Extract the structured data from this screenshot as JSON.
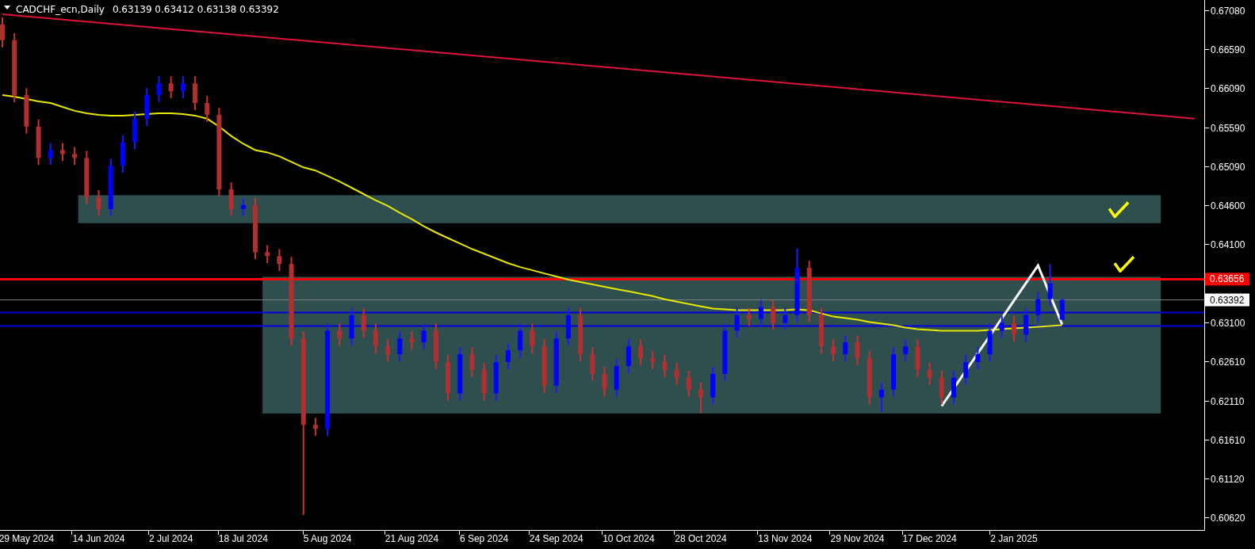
{
  "header": {
    "symbol": "CADCHF_ecn,Daily",
    "quotes": "0.63139 0.63412 0.63138 0.63392"
  },
  "chart": {
    "chart_data": {
      "type": "candlestick",
      "ylim": [
        0.60461,
        0.67212
      ],
      "yticks": [
        {
          "value": 0.6708,
          "label": "0.67080"
        },
        {
          "value": 0.6659,
          "label": "0.66590"
        },
        {
          "value": 0.6609,
          "label": "0.66090"
        },
        {
          "value": 0.6559,
          "label": "0.65590"
        },
        {
          "value": 0.6509,
          "label": "0.65090"
        },
        {
          "value": 0.646,
          "label": "0.64600"
        },
        {
          "value": 0.641,
          "label": "0.64100"
        },
        {
          "value": 0.631,
          "label": "0.63100"
        },
        {
          "value": 0.6261,
          "label": "0.62610"
        },
        {
          "value": 0.6211,
          "label": "0.62110"
        },
        {
          "value": 0.6161,
          "label": "0.61610"
        },
        {
          "value": 0.6112,
          "label": "0.61120"
        },
        {
          "value": 0.6062,
          "label": "0.60620"
        }
      ],
      "categories": [
        null,
        null,
        "29 May 2024",
        null,
        null,
        null,
        null,
        null,
        "14 Jun 2024",
        null,
        null,
        null,
        null,
        null,
        "2 Jul 2024",
        null,
        null,
        null,
        null,
        null,
        "18 Jul 2024",
        null,
        null,
        null,
        null,
        null,
        null,
        "5 Aug 2024",
        null,
        null,
        null,
        null,
        null,
        null,
        "21 Aug 2024",
        null,
        null,
        null,
        null,
        null,
        "6 Sep 2024",
        null,
        null,
        null,
        null,
        null,
        "24 Sep 2024",
        null,
        null,
        null,
        null,
        null,
        "10 Oct 2024",
        null,
        null,
        null,
        null,
        null,
        "28 Oct 2024",
        null,
        null,
        null,
        null,
        null,
        null,
        "13 Nov 2024",
        null,
        null,
        null,
        null,
        null,
        "29 Nov 2024",
        null,
        null,
        null,
        null,
        null,
        "17 Dec 2024",
        null,
        null,
        null,
        null,
        null,
        null,
        "2 Jan 2025",
        null,
        null,
        null,
        null,
        null,
        null,
        null,
        null,
        null,
        null,
        null,
        null,
        null,
        null,
        null
      ],
      "ohlc": [
        [
          0.669,
          0.6699,
          0.6661,
          0.667
        ],
        [
          0.667,
          0.6679,
          0.6591,
          0.66
        ],
        [
          0.66,
          0.6609,
          0.6551,
          0.656
        ],
        [
          0.656,
          0.6569,
          0.6511,
          0.652
        ],
        [
          0.652,
          0.6539,
          0.6511,
          0.653
        ],
        [
          0.653,
          0.6539,
          0.6516,
          0.6525
        ],
        [
          0.6525,
          0.6534,
          0.6511,
          0.652
        ],
        [
          0.652,
          0.6529,
          0.6461,
          0.647
        ],
        [
          0.647,
          0.6479,
          0.6446,
          0.6455
        ],
        [
          0.6455,
          0.6519,
          0.6446,
          0.651
        ],
        [
          0.651,
          0.6549,
          0.6501,
          0.654
        ],
        [
          0.654,
          0.6579,
          0.6531,
          0.657
        ],
        [
          0.657,
          0.6609,
          0.6561,
          0.66
        ],
        [
          0.66,
          0.6624,
          0.6591,
          0.6615
        ],
        [
          0.6615,
          0.6624,
          0.6596,
          0.6605
        ],
        [
          0.6605,
          0.6624,
          0.6596,
          0.6615
        ],
        [
          0.6615,
          0.6624,
          0.6581,
          0.659
        ],
        [
          0.659,
          0.6599,
          0.6566,
          0.6575
        ],
        [
          0.6575,
          0.6584,
          0.6471,
          0.648
        ],
        [
          0.648,
          0.6489,
          0.6446,
          0.6455
        ],
        [
          0.6455,
          0.6469,
          0.6446,
          0.646
        ],
        [
          0.646,
          0.6469,
          0.6391,
          0.64
        ],
        [
          0.64,
          0.6409,
          0.6386,
          0.6395
        ],
        [
          0.6395,
          0.6404,
          0.6376,
          0.6385
        ],
        [
          0.6385,
          0.6394,
          0.6281,
          0.629
        ],
        [
          0.629,
          0.6299,
          0.6065,
          0.618
        ],
        [
          0.618,
          0.6189,
          0.6166,
          0.6175
        ],
        [
          0.6175,
          0.6309,
          0.6166,
          0.63
        ],
        [
          0.63,
          0.6309,
          0.6281,
          0.629
        ],
        [
          0.629,
          0.6329,
          0.6281,
          0.632
        ],
        [
          0.632,
          0.6329,
          0.6291,
          0.63
        ],
        [
          0.63,
          0.6309,
          0.6271,
          0.628
        ],
        [
          0.628,
          0.6289,
          0.6261,
          0.627
        ],
        [
          0.627,
          0.6299,
          0.6261,
          0.629
        ],
        [
          0.629,
          0.6299,
          0.6276,
          0.6285
        ],
        [
          0.6285,
          0.6309,
          0.6276,
          0.63
        ],
        [
          0.63,
          0.6309,
          0.6251,
          0.626
        ],
        [
          0.626,
          0.6269,
          0.6211,
          0.622
        ],
        [
          0.622,
          0.6279,
          0.6211,
          0.627
        ],
        [
          0.627,
          0.6279,
          0.6241,
          0.625
        ],
        [
          0.625,
          0.6259,
          0.6211,
          0.622
        ],
        [
          0.622,
          0.6269,
          0.6211,
          0.626
        ],
        [
          0.626,
          0.6284,
          0.6251,
          0.6275
        ],
        [
          0.6275,
          0.6309,
          0.6266,
          0.63
        ],
        [
          0.63,
          0.6309,
          0.6271,
          0.628
        ],
        [
          0.628,
          0.6289,
          0.6221,
          0.623
        ],
        [
          0.623,
          0.6299,
          0.6221,
          0.629
        ],
        [
          0.629,
          0.6329,
          0.6281,
          0.632
        ],
        [
          0.632,
          0.6329,
          0.6261,
          0.627
        ],
        [
          0.627,
          0.6279,
          0.6236,
          0.6245
        ],
        [
          0.6245,
          0.6254,
          0.6216,
          0.6225
        ],
        [
          0.6225,
          0.6264,
          0.6216,
          0.6255
        ],
        [
          0.6255,
          0.6289,
          0.6246,
          0.628
        ],
        [
          0.628,
          0.6289,
          0.6256,
          0.6265
        ],
        [
          0.6265,
          0.6274,
          0.6251,
          0.626
        ],
        [
          0.626,
          0.6269,
          0.6241,
          0.625
        ],
        [
          0.625,
          0.6259,
          0.6231,
          0.624
        ],
        [
          0.624,
          0.6249,
          0.6216,
          0.6225
        ],
        [
          0.6225,
          0.6234,
          0.6195,
          0.6215
        ],
        [
          0.6215,
          0.6254,
          0.6206,
          0.6245
        ],
        [
          0.6245,
          0.6309,
          0.6236,
          0.63
        ],
        [
          0.63,
          0.6329,
          0.6291,
          0.632
        ],
        [
          0.632,
          0.6329,
          0.6306,
          0.6315
        ],
        [
          0.6315,
          0.6339,
          0.6306,
          0.633
        ],
        [
          0.633,
          0.6339,
          0.6301,
          0.631
        ],
        [
          0.631,
          0.6329,
          0.6301,
          0.632
        ],
        [
          0.632,
          0.6405,
          0.6311,
          0.638
        ],
        [
          0.638,
          0.6389,
          0.6311,
          0.632
        ],
        [
          0.632,
          0.6329,
          0.6271,
          0.628
        ],
        [
          0.628,
          0.6289,
          0.6261,
          0.627
        ],
        [
          0.627,
          0.6294,
          0.6261,
          0.6285
        ],
        [
          0.6285,
          0.6294,
          0.6256,
          0.6265
        ],
        [
          0.6265,
          0.6274,
          0.6206,
          0.6215
        ],
        [
          0.6215,
          0.6234,
          0.6196,
          0.6225
        ],
        [
          0.6225,
          0.6279,
          0.6216,
          0.627
        ],
        [
          0.627,
          0.6289,
          0.6261,
          0.628
        ],
        [
          0.628,
          0.6289,
          0.6241,
          0.625
        ],
        [
          0.625,
          0.6259,
          0.6231,
          0.624
        ],
        [
          0.624,
          0.6249,
          0.6206,
          0.6215
        ],
        [
          0.6215,
          0.6249,
          0.6206,
          0.624
        ],
        [
          0.624,
          0.6269,
          0.6231,
          0.626
        ],
        [
          0.626,
          0.6279,
          0.6251,
          0.627
        ],
        [
          0.627,
          0.6309,
          0.6261,
          0.63
        ],
        [
          0.63,
          0.6319,
          0.6291,
          0.631
        ],
        [
          0.631,
          0.6319,
          0.6286,
          0.6295
        ],
        [
          0.6295,
          0.6329,
          0.6286,
          0.632
        ],
        [
          0.632,
          0.6349,
          0.6311,
          0.634
        ],
        [
          0.634,
          0.6385,
          0.6331,
          0.636
        ],
        [
          0.63139,
          0.63412,
          0.63138,
          0.63392
        ],
        null,
        null,
        null,
        null,
        null,
        null,
        null,
        null,
        null,
        null,
        null
      ],
      "series": [
        {
          "type": "line",
          "color": "#e8e800",
          "values": [
            0.66,
            0.6598,
            0.6595,
            0.6592,
            0.659,
            0.6585,
            0.658,
            0.6577,
            0.6575,
            0.6574,
            0.6574,
            0.6575,
            0.6576,
            0.6577,
            0.6577,
            0.6576,
            0.6574,
            0.657,
            0.656,
            0.6548,
            0.6538,
            0.653,
            0.6527,
            0.6522,
            0.6515,
            0.6508,
            0.6504,
            0.6497,
            0.649,
            0.6482,
            0.6474,
            0.6466,
            0.6459,
            0.645,
            0.6442,
            0.6433,
            0.6425,
            0.6418,
            0.6411,
            0.6404,
            0.6398,
            0.6392,
            0.6386,
            0.6381,
            0.6377,
            0.6373,
            0.6369,
            0.6365,
            0.6362,
            0.6359,
            0.6356,
            0.6353,
            0.635,
            0.6347,
            0.6344,
            0.634,
            0.6337,
            0.6334,
            0.6331,
            0.6328,
            0.6327,
            0.6326,
            0.6326,
            0.6326,
            0.6326,
            0.6326,
            0.6327,
            0.6326,
            0.6322,
            0.6318,
            0.6316,
            0.6314,
            0.6311,
            0.6309,
            0.6307,
            0.6304,
            0.6302,
            0.6301,
            0.63,
            0.63,
            0.63,
            0.63,
            0.6301,
            0.6302,
            0.6303,
            0.6304,
            0.6305,
            0.6306,
            0.6307,
            null,
            null,
            null,
            null,
            null,
            null,
            null,
            null,
            null,
            null,
            null
          ]
        },
        {
          "type": "line",
          "color": "#ffffff",
          "values": [
            null,
            null,
            null,
            null,
            null,
            null,
            null,
            null,
            null,
            null,
            null,
            null,
            null,
            null,
            null,
            null,
            null,
            null,
            null,
            null,
            null,
            null,
            null,
            null,
            null,
            null,
            null,
            null,
            null,
            null,
            null,
            null,
            null,
            null,
            null,
            null,
            null,
            null,
            null,
            null,
            null,
            null,
            null,
            null,
            null,
            null,
            null,
            null,
            null,
            null,
            null,
            null,
            null,
            null,
            null,
            null,
            null,
            null,
            null,
            null,
            null,
            null,
            null,
            null,
            null,
            null,
            null,
            null,
            null,
            null,
            null,
            null,
            null,
            null,
            null,
            null,
            null,
            null,
            0.6204,
            null,
            null,
            null,
            null,
            null,
            null,
            null,
            0.6383,
            null,
            0.6308,
            null,
            null,
            null,
            null,
            null,
            null,
            null,
            null,
            null,
            null,
            null
          ]
        },
        {
          "type": "line",
          "color": "#dc143c",
          "values": [
            0.6703,
            null,
            null,
            null,
            null,
            null,
            null,
            null,
            null,
            null,
            null,
            null,
            null,
            null,
            null,
            null,
            null,
            null,
            null,
            null,
            null,
            null,
            null,
            null,
            null,
            null,
            null,
            null,
            null,
            null,
            null,
            null,
            null,
            null,
            null,
            null,
            null,
            null,
            null,
            null,
            null,
            null,
            null,
            null,
            null,
            null,
            null,
            null,
            null,
            null,
            null,
            null,
            null,
            null,
            null,
            null,
            null,
            null,
            null,
            null,
            null,
            null,
            null,
            null,
            null,
            null,
            null,
            null,
            null,
            null,
            null,
            null,
            null,
            null,
            null,
            null,
            null,
            null,
            null,
            null,
            null,
            null,
            null,
            null,
            null,
            null,
            null,
            null,
            null,
            null,
            null,
            null,
            null,
            null,
            null,
            null,
            null,
            null,
            null,
            0.657
          ]
        }
      ],
      "bands": [
        {
          "axis": "y",
          "from": 0.64369,
          "to": 0.64726,
          "color": "#2f4f4f"
        },
        {
          "axis": "y",
          "from": 0.61945,
          "to": 0.63687,
          "color": "#2f4f4f"
        }
      ],
      "ref_lines": [
        {
          "axis": "y",
          "value": 0.63392,
          "color": "#808080",
          "label": "0.63392"
        },
        {
          "axis": "y",
          "value": 0.6323,
          "color": "#0000e0"
        },
        {
          "axis": "y",
          "value": 0.6306,
          "color": "#0000e0"
        },
        {
          "axis": "y",
          "value": 0.63656,
          "color": "#ff0000",
          "label": "0.63656"
        }
      ]
    }
  }
}
